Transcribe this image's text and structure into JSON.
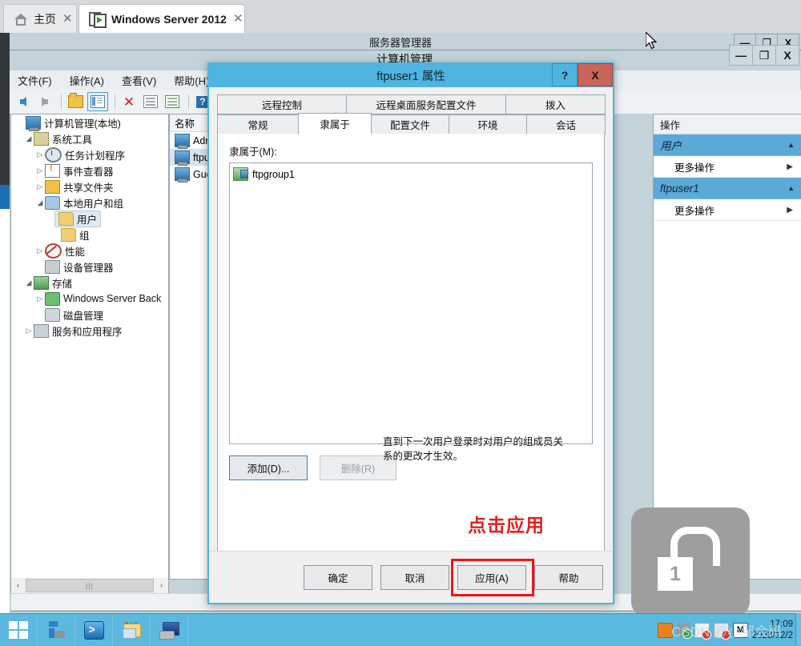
{
  "browser": {
    "tabs": [
      {
        "label": "主页",
        "icon": "home-icon",
        "active": false
      },
      {
        "label": "Windows Server 2012",
        "icon": "server-screen-icon",
        "active": true
      }
    ],
    "close_glyph": "✕"
  },
  "server_manager": {
    "title": "服务器管理器",
    "window_controls": [
      {
        "name": "minimize",
        "glyph": "—"
      },
      {
        "name": "restore",
        "glyph": "❐"
      },
      {
        "name": "close",
        "glyph": "X"
      }
    ]
  },
  "computer_management": {
    "title": "计算机管理",
    "window_controls": [
      {
        "name": "minimize",
        "glyph": "—"
      },
      {
        "name": "maximize",
        "glyph": "❐"
      },
      {
        "name": "close",
        "glyph": "X"
      }
    ],
    "menu": [
      "文件(F)",
      "操作(A)",
      "查看(V)",
      "帮助(H)"
    ],
    "toolbar_icons": [
      "back-arrow-icon",
      "forward-arrow-icon",
      "open-folder-icon",
      "show-tree-pane-icon",
      "delete-icon",
      "properties-icon",
      "export-list-icon",
      "help-icon",
      "show-action-pane-icon"
    ],
    "tree": [
      {
        "label": "计算机管理(本地)",
        "indent": 0,
        "expander": "",
        "icon": "computer-icon"
      },
      {
        "label": "系统工具",
        "indent": 1,
        "expander": "◢",
        "icon": "tools-icon"
      },
      {
        "label": "任务计划程序",
        "indent": 2,
        "expander": "▷",
        "icon": "clock-icon"
      },
      {
        "label": "事件查看器",
        "indent": 2,
        "expander": "▷",
        "icon": "event-viewer-icon"
      },
      {
        "label": "共享文件夹",
        "indent": 2,
        "expander": "▷",
        "icon": "shared-folder-icon"
      },
      {
        "label": "本地用户和组",
        "indent": 2,
        "expander": "◢",
        "icon": "users-groups-icon"
      },
      {
        "label": "用户",
        "indent": 3,
        "expander": "",
        "icon": "folder-icon",
        "selected": true
      },
      {
        "label": "组",
        "indent": 3,
        "expander": "",
        "icon": "folder-icon"
      },
      {
        "label": "性能",
        "indent": 2,
        "expander": "▷",
        "icon": "performance-icon"
      },
      {
        "label": "设备管理器",
        "indent": 2,
        "expander": "",
        "icon": "device-manager-icon"
      },
      {
        "label": "存储",
        "indent": 1,
        "expander": "◢",
        "icon": "storage-icon"
      },
      {
        "label": "Windows Server Back",
        "indent": 2,
        "expander": "▷",
        "icon": "backup-icon"
      },
      {
        "label": "磁盘管理",
        "indent": 2,
        "expander": "",
        "icon": "disk-icon"
      },
      {
        "label": "服务和应用程序",
        "indent": 1,
        "expander": "▷",
        "icon": "services-icon"
      }
    ],
    "list": {
      "column_header": "名称",
      "rows": [
        {
          "label": "Adm",
          "selected": false
        },
        {
          "label": "ftpu",
          "selected": true
        },
        {
          "label": "Gue",
          "selected": false
        }
      ]
    },
    "actions": {
      "header": "操作",
      "groups": [
        {
          "title": "用户",
          "collapse_glyph": "▲",
          "items": [
            {
              "label": "更多操作",
              "arrow": "▶"
            }
          ]
        },
        {
          "title": "ftpuser1",
          "collapse_glyph": "▲",
          "items": [
            {
              "label": "更多操作",
              "arrow": "▶"
            }
          ]
        }
      ]
    },
    "scrollbar": {
      "left_glyph": "‹",
      "right_glyph": "›",
      "thumb_glyph": "|||"
    }
  },
  "dialog": {
    "title": "ftpuser1 属性",
    "help_glyph": "?",
    "close_glyph": "X",
    "tabs_row1": [
      "远程控制",
      "远程桌面服务配置文件",
      "拨入"
    ],
    "tabs_row2": [
      "常规",
      "隶属于",
      "配置文件",
      "环境",
      "会话"
    ],
    "active_tab": "隶属于",
    "member_label": "隶属于(M):",
    "members": [
      {
        "label": "ftpgroup1",
        "icon": "group-icon"
      }
    ],
    "add_button": "添加(D)...",
    "remove_button": "删除(R)",
    "hint": "直到下一次用户登录时对用户的组成员关系的更改才生效。",
    "annotation": "点击应用",
    "footer_buttons": [
      {
        "label": "确定",
        "name": "ok-button",
        "highlight": false
      },
      {
        "label": "取消",
        "name": "cancel-button",
        "highlight": false
      },
      {
        "label": "应用(A)",
        "name": "apply-button",
        "highlight": true
      },
      {
        "label": "帮助",
        "name": "help-button",
        "highlight": false
      }
    ],
    "highlight_color": "#f21313",
    "titlebar_color": "#4fb4e0"
  },
  "overlay": {
    "lock_badge_number": "1",
    "lock_badge_icon": "unlock-icon"
  },
  "taskbar": {
    "start_icon": "windows-start-icon",
    "pinned": [
      {
        "name": "server-manager-taskbar-icon"
      },
      {
        "name": "powershell-taskbar-icon"
      },
      {
        "name": "file-explorer-taskbar-icon"
      },
      {
        "name": "computer-management-taskbar-icon"
      }
    ],
    "tray": [
      {
        "name": "java-tray-icon"
      },
      {
        "name": "usb-safely-remove-tray-icon"
      },
      {
        "name": "flag-action-center-tray-icon"
      },
      {
        "name": "network-tray-icon"
      },
      {
        "name": "ime-tray-icon",
        "glyph": "M"
      }
    ],
    "clock_time": "17:09",
    "clock_date": "2023/12/2",
    "watermark": "CSDN @小邹会码"
  }
}
